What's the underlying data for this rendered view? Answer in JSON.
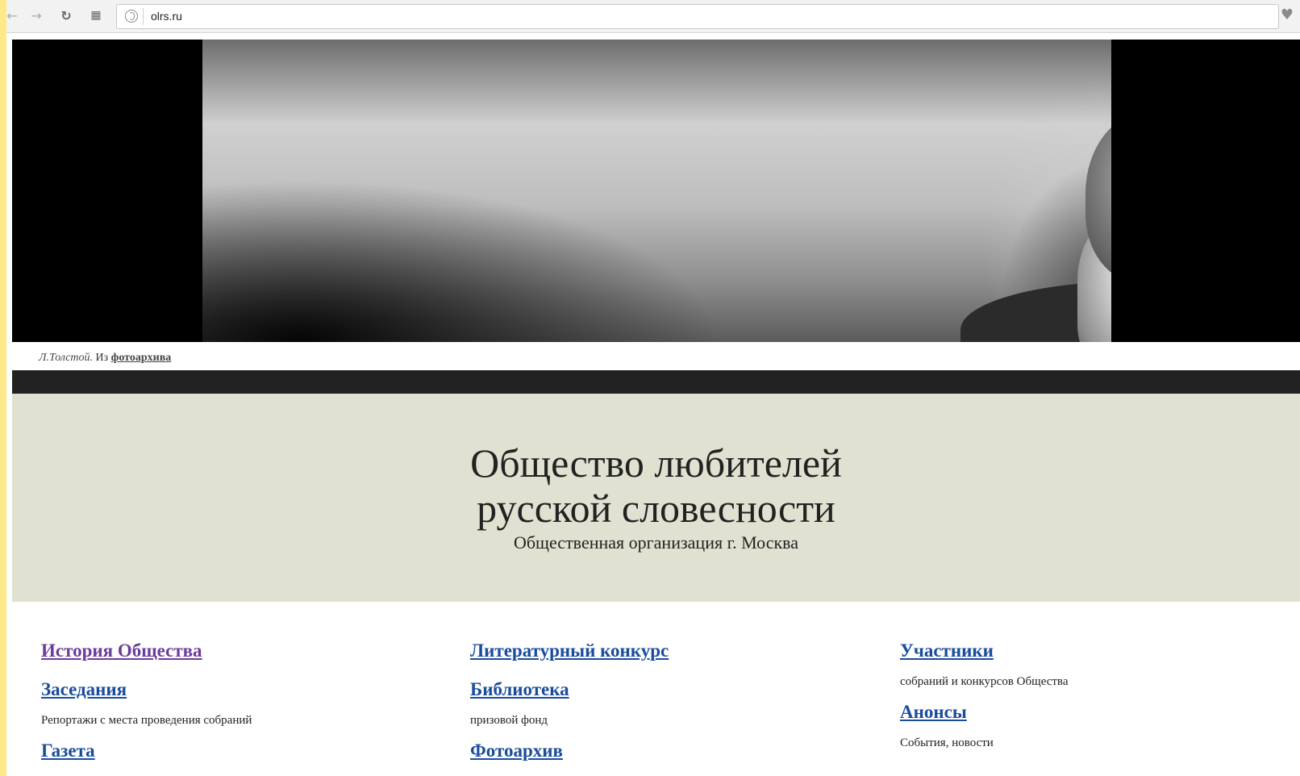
{
  "browser": {
    "url": "olrs.ru"
  },
  "banner": {
    "caption_author": "Л.Толстой.",
    "caption_from": "Из",
    "caption_link": "фотоархива"
  },
  "hero": {
    "title_line1": "Общество любителей",
    "title_line2": "русской словесности",
    "subtitle": "Общественная организация г. Москва"
  },
  "columns": [
    {
      "items": [
        {
          "label": "История Общества",
          "desc": ""
        },
        {
          "label": "Заседания",
          "desc": "Репортажи с места проведения собраний"
        },
        {
          "label": "Газета",
          "desc": ""
        }
      ]
    },
    {
      "items": [
        {
          "label": "Литературный конкурс",
          "desc": ""
        },
        {
          "label": "Библиотека",
          "desc": "призовой фонд"
        },
        {
          "label": "Фотоархив",
          "desc": ""
        }
      ]
    },
    {
      "items": [
        {
          "label": "Участники",
          "desc": "собраний и конкурсов Общества"
        },
        {
          "label": "Анонсы",
          "desc": "События, новости"
        }
      ]
    }
  ],
  "colors": {
    "link": "#1a4c9c",
    "visited_link": "#6a3d9a",
    "hero_bg": "#e1e1d1",
    "page_frame": "#fde98a"
  }
}
